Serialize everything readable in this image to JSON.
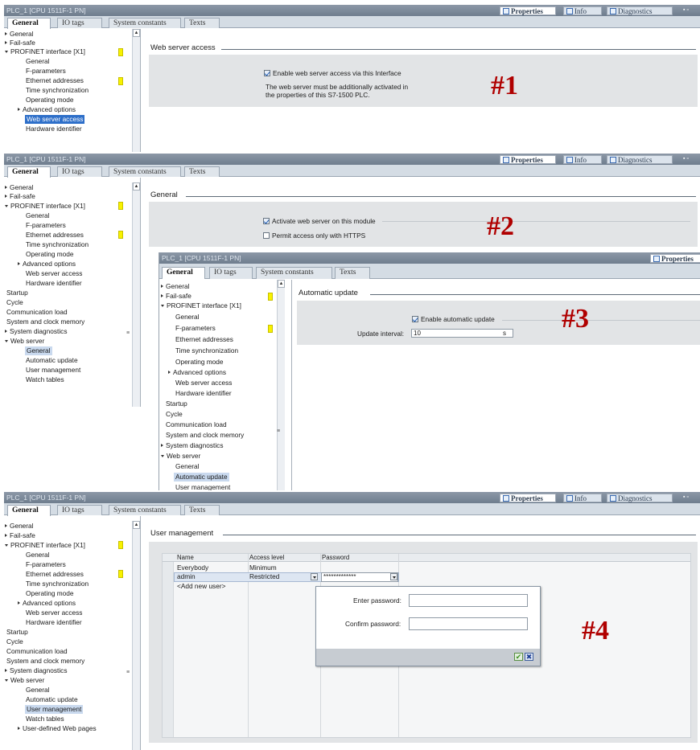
{
  "window_title": "PLC_1 [CPU 1511F-1 PN]",
  "window_title_small": "PLC_1 [CPU 1511F-1 PN]",
  "right_tabs": {
    "properties": "Properties",
    "info": "Info",
    "diagnostics": "Diagnostics"
  },
  "tabs": {
    "general": "General",
    "io_tags": "IO tags",
    "system_constants": "System constants",
    "texts": "Texts"
  },
  "nav": {
    "general": "General",
    "fail_safe": "Fail-safe",
    "profinet": "PROFINET interface [X1]",
    "sub_general": "General",
    "f_parameters": "F-parameters",
    "ethernet": "Ethernet addresses",
    "time_sync": "Time synchronization",
    "operating_mode": "Operating mode",
    "advanced": "Advanced options",
    "web_access": "Web server access",
    "hw_id": "Hardware identifier",
    "startup": "Startup",
    "cycle": "Cycle",
    "comm_load": "Communication load",
    "sys_clock": "System and clock memory",
    "sys_diag": "System diagnostics",
    "web_server": "Web server",
    "ws_general": "General",
    "auto_update": "Automatic update",
    "user_mgmt": "User management",
    "watch_tables": "Watch tables",
    "user_pages": "User-defined Web pages"
  },
  "panel1": {
    "section": "Web server access",
    "checkbox": "Enable web server access via this Interface",
    "note1": "The web server must be additionally activated in",
    "note2": "the properties of this S7-1500 PLC.",
    "marker": "#1"
  },
  "panel2": {
    "section": "General",
    "activate": "Activate web server on this module",
    "https": "Permit access only with HTTPS",
    "marker": "#2"
  },
  "panel3": {
    "section": "Automatic update",
    "enable": "Enable automatic update",
    "interval_label": "Update interval:",
    "interval_value": "10",
    "unit": "s",
    "marker": "#3"
  },
  "panel4": {
    "section": "User management",
    "col_name": "Name",
    "col_access": "Access level",
    "col_password": "Password",
    "rows": [
      {
        "name": "Everybody",
        "access": "Minimum",
        "password": ""
      },
      {
        "name": "admin",
        "access": "Restricted",
        "password": "*************"
      }
    ],
    "add_user": "<Add new user>",
    "enter_pw": "Enter password:",
    "confirm_pw": "Confirm password:",
    "marker": "#4"
  },
  "colors": {
    "titlebar": "#7b8898",
    "selected": "#2e6fc9",
    "marker": "#b00000",
    "section_box": "#e2e4e6"
  }
}
